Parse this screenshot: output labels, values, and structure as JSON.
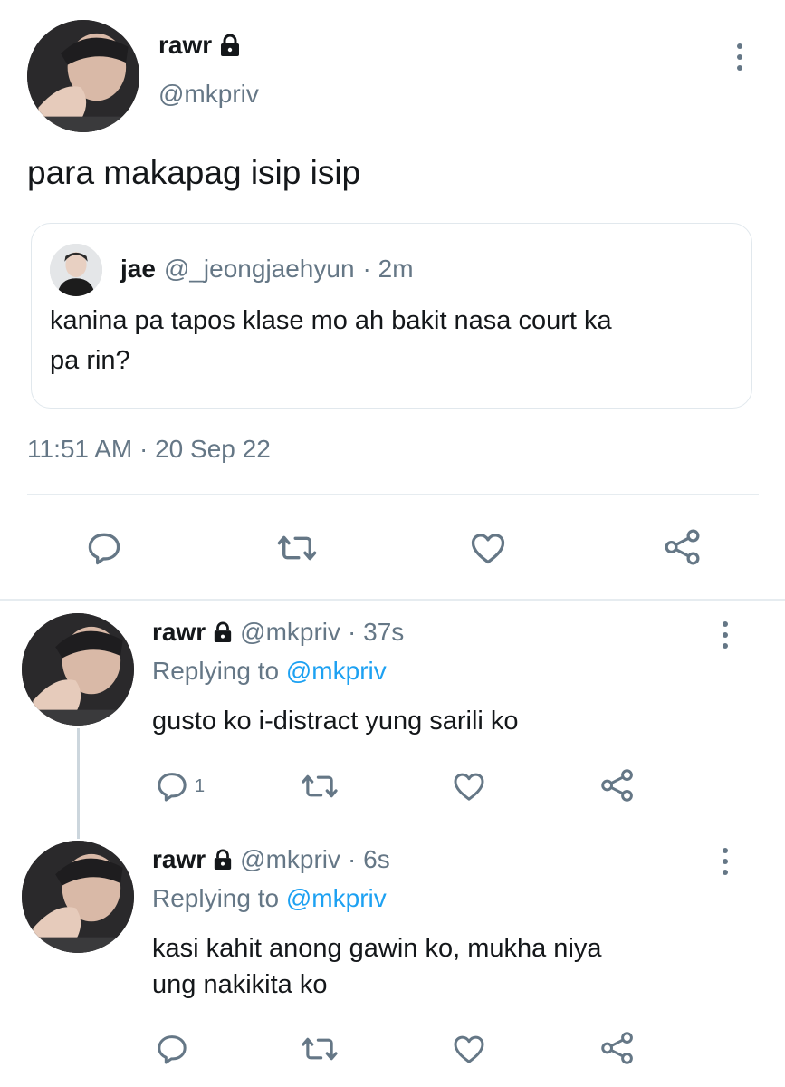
{
  "main_tweet": {
    "display_name": "rawr",
    "handle": "@mkpriv",
    "text": "para makapag isip isip",
    "timestamp": "11:51 AM · 20 Sep 22",
    "quoted": {
      "display_name": "jae",
      "handle": "@_jeongjaehyun",
      "time": "· 2m",
      "text_line1": "kanina pa tapos klase mo ah bakit nasa court ka",
      "text_line2": "pa rin?"
    }
  },
  "replies": [
    {
      "display_name": "rawr",
      "handle": "@mkpriv",
      "time": "· 37s",
      "replying_prefix": "Replying to",
      "replying_handle": "@mkpriv",
      "text_line1": "gusto ko i-distract yung sarili ko",
      "text_line2": "",
      "reply_count": "1"
    },
    {
      "display_name": "rawr",
      "handle": "@mkpriv",
      "time": "· 6s",
      "replying_prefix": "Replying to",
      "replying_handle": "@mkpriv",
      "text_line1": "kasi kahit anong gawin ko, mukha niya",
      "text_line2": "ung nakikita ko",
      "reply_count": ""
    }
  ],
  "colors": {
    "accent": "#1da1f2",
    "muted": "#657786",
    "text": "#14171a",
    "border": "#e1e8ed"
  },
  "icons": [
    "lock-icon",
    "more-icon",
    "reply-icon",
    "retweet-icon",
    "like-icon",
    "share-icon"
  ]
}
